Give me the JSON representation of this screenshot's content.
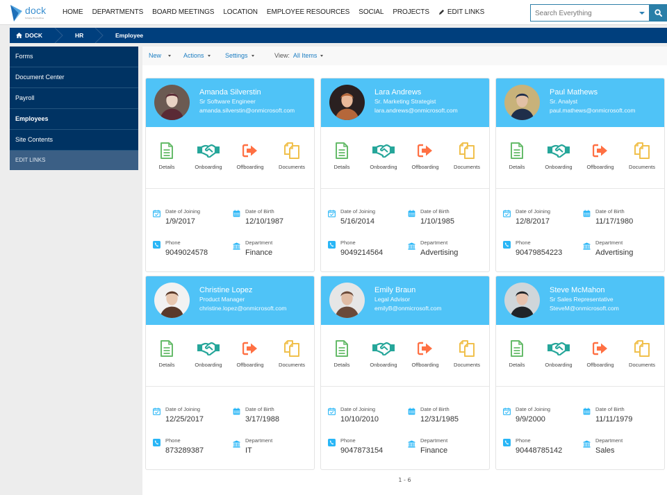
{
  "brand": {
    "name": "dock",
    "tagline": "Simply Productive"
  },
  "nav": {
    "items": [
      "HOME",
      "DEPARTMENTS",
      "BOARD MEETINGS",
      "LOCATION",
      "EMPLOYEE RESOURCES",
      "SOCIAL",
      "PROJECTS"
    ],
    "edit_links": "EDIT LINKS"
  },
  "search": {
    "placeholder": "Search Everything"
  },
  "breadcrumb": [
    "DOCK",
    "HR",
    "Employee"
  ],
  "sidebar": {
    "items": [
      {
        "label": "Forms"
      },
      {
        "label": "Document Center"
      },
      {
        "label": "Payroll"
      },
      {
        "label": "Employees",
        "active": true
      },
      {
        "label": "Site Contents"
      }
    ],
    "edit_links": "EDIT LINKS"
  },
  "toolbar": {
    "new": "New",
    "actions": "Actions",
    "settings": "Settings",
    "view_label": "View:",
    "view_value": "All Items"
  },
  "card_labels": {
    "actions": [
      "Details",
      "Onboarding",
      "Offboarding",
      "Documents"
    ],
    "date_of_joining": "Date of Joining",
    "date_of_birth": "Date of Birth",
    "phone": "Phone",
    "department": "Department"
  },
  "colors": {
    "header_blue": "#4fc3f7",
    "nav_dark": "#003f7d",
    "details_green": "#66bb6a",
    "onboarding_teal": "#26a69a",
    "offboarding_orange": "#ff7043",
    "documents_yellow": "#f0c04c",
    "info_icon_blue": "#29b6f6"
  },
  "employees": [
    {
      "name": "Amanda Silverstin",
      "title": "Sr Software Engineer",
      "email": "amanda.silverstin@onmicrosoft.com",
      "joining": "1/9/2017",
      "birth": "12/10/1987",
      "phone": "9049024578",
      "department": "Finance"
    },
    {
      "name": "Lara Andrews",
      "title": "Sr. Marketing Strategist",
      "email": "lara.andrews@onmicrosoft.com",
      "joining": "5/16/2014",
      "birth": "1/10/1985",
      "phone": "9049214564",
      "department": "Advertising"
    },
    {
      "name": "Paul Mathews",
      "title": "Sr. Analyst",
      "email": "paul.mathews@onmicrosoft.com",
      "joining": "12/8/2017",
      "birth": "11/17/1980",
      "phone": "90479854223",
      "department": "Advertising"
    },
    {
      "name": "Christine Lopez",
      "title": "Product Manager",
      "email": "christine.lopez@onmicrosoft.com",
      "joining": "12/25/2017",
      "birth": "3/17/1988",
      "phone": "873289387",
      "department": "IT"
    },
    {
      "name": "Emily Braun",
      "title": "Legal Advisor",
      "email": "emilyB@onmicrosoft.com",
      "joining": "10/10/2010",
      "birth": "12/31/1985",
      "phone": "9047873154",
      "department": "Finance"
    },
    {
      "name": "Steve McMahon",
      "title": "Sr Sales Representative",
      "email": "SteveM@onmicrosoft.com",
      "joining": "9/9/2000",
      "birth": "11/11/1979",
      "phone": "90448785142",
      "department": "Sales"
    }
  ],
  "pager": {
    "range": "1 - 6"
  }
}
